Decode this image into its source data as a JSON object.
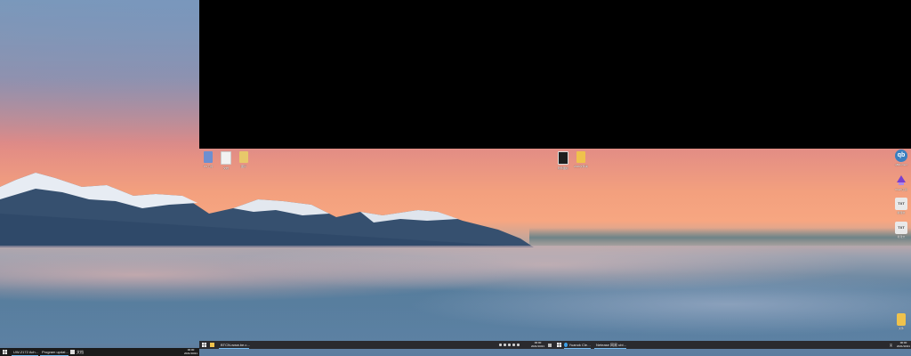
{
  "desktop": {
    "top_icons": [
      {
        "label": "PC工具",
        "color": "#6d8fd0"
      },
      {
        "label": "文档",
        "color": "#f2f2f2"
      },
      {
        "label": "图片",
        "color": "#e8c86a"
      },
      {
        "label": "软件图标",
        "color": "#1e1e1e"
      },
      {
        "label": "2019文件夹",
        "color": "#efc24c"
      }
    ],
    "right_icons": [
      {
        "label": "qBittorrent",
        "text": "qb",
        "color": "#3a7fc0"
      },
      {
        "label": "Clash工具",
        "text": "",
        "color": "#7a3fd0"
      },
      {
        "label": "新建文",
        "text": "TXT",
        "color": "#e9e9e9"
      },
      {
        "label": "新建文",
        "text": "TXT",
        "color": "#e9e9e9"
      },
      {
        "label": "文件",
        "text": "",
        "color": "#efc24c"
      }
    ]
  },
  "taskbar_left": {
    "items": [
      {
        "label": "UW-2172 Ach…",
        "icon_color": "#1f8ad1"
      },
      {
        "label": "Program updat…",
        "icon_color": "#5a6ad6"
      },
      {
        "label": "文档",
        "icon_color": "#dcdcdc"
      }
    ],
    "clock": {
      "time": "00:00",
      "date": "2021/10/21"
    }
  },
  "taskbar_right": {
    "items": [
      {
        "label": "BTCN-www.be.c…",
        "icon_color": "#d43a2f"
      },
      {
        "label": "Yuanok Cle…",
        "icon_color": "#3ea0e8"
      },
      {
        "label": "Netease 网易 ubi…",
        "icon_color": "#d43a2f"
      }
    ],
    "center_clock": {
      "time": "00:00",
      "date": "2021/10/21"
    },
    "right_clock": {
      "time": "00:00",
      "date": "2021/10/21"
    },
    "ime": "英"
  }
}
